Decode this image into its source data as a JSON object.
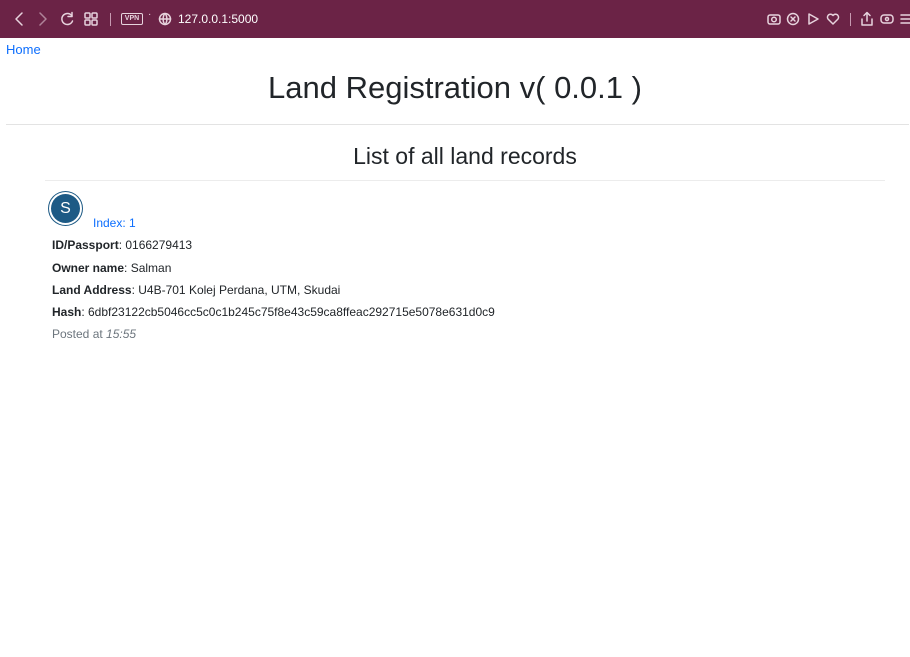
{
  "browser": {
    "url": "127.0.0.1:5000",
    "vpn_label": "VPN",
    "icons": [
      "back-icon",
      "forward-icon",
      "reload-icon",
      "tabs-grid-icon",
      "vpn-badge",
      "globe-icon",
      "camera-icon",
      "shield-icon",
      "play-icon",
      "heart-icon",
      "share-icon",
      "battery-icon",
      "menu-icon"
    ]
  },
  "nav": {
    "home_label": "Home"
  },
  "header": {
    "title": "Land Registration v( 0.0.1 )"
  },
  "section": {
    "title": "List of all land records"
  },
  "records": [
    {
      "avatar_letter": "S",
      "index_label": "Index: 1",
      "id_label": "ID/Passport",
      "id_value": ": 0166279413",
      "owner_label": "Owner name",
      "owner_value": ": Salman",
      "address_label": "Land Address",
      "address_value": ": U4B-701 Kolej Perdana, UTM, Skudai",
      "hash_label": "Hash",
      "hash_value": ": 6dbf23122cb5046cc5c0c1b245c75f8e43c59ca8ffeac292715e5078e631d0c9",
      "posted_prefix": "Posted at ",
      "posted_time": "15:55"
    }
  ],
  "colors": {
    "toolbar_bg": "#6b2346",
    "link": "#0d6efd",
    "avatar_bg": "#1d5a85",
    "muted": "#6c757d"
  }
}
